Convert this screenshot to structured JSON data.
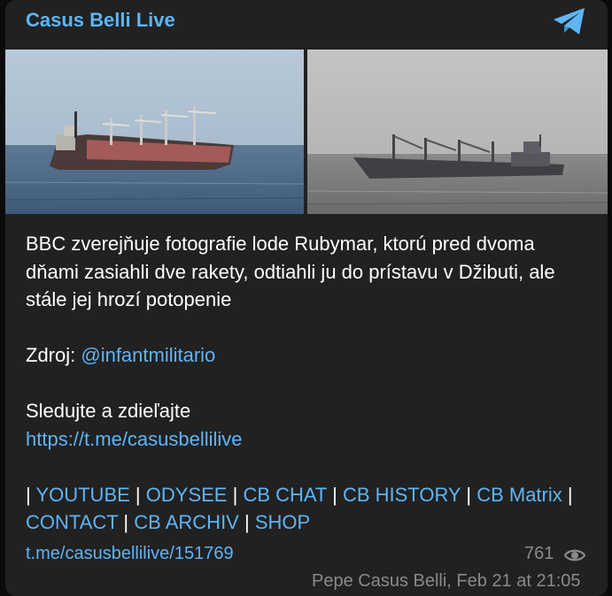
{
  "channel": {
    "title": "Casus Belli Live",
    "icon": "telegram-plane-icon",
    "accent": "#5eb5f7"
  },
  "photos": [
    {
      "name": "photo-ship-left",
      "description": "ship-photo"
    },
    {
      "name": "photo-ship-right",
      "description": "ship-photo"
    }
  ],
  "post": {
    "paragraph1": "BBC zverejňuje fotografie lode Rubymar, ktorú pred dvoma dňami zasiahli dve rakety, odtiahli ju do prístavu v Džibuti, ale stále jej hrozí potopenie",
    "source_label": "Zdroj: ",
    "source_handle": "@infantmilitario",
    "follow_text": "Sledujte a zdieľajte",
    "channel_url": "https://t.me/casusbellilive",
    "links": {
      "youtube": "YOUTUBE",
      "odysee": "ODYSEE",
      "cb_chat": "CB CHAT",
      "cb_history": "CB HISTORY",
      "cb_matrix": "CB Matrix",
      "contact": "CONTACT",
      "cb_archiv": "CB ARCHIV",
      "shop": "SHOP"
    },
    "separator": "|"
  },
  "footer": {
    "post_link": "t.me/casusbellilive/151769",
    "views": "761",
    "views_icon": "eye-icon",
    "author_date": "Pepe Casus Belli, Feb 21 at 21:05"
  }
}
